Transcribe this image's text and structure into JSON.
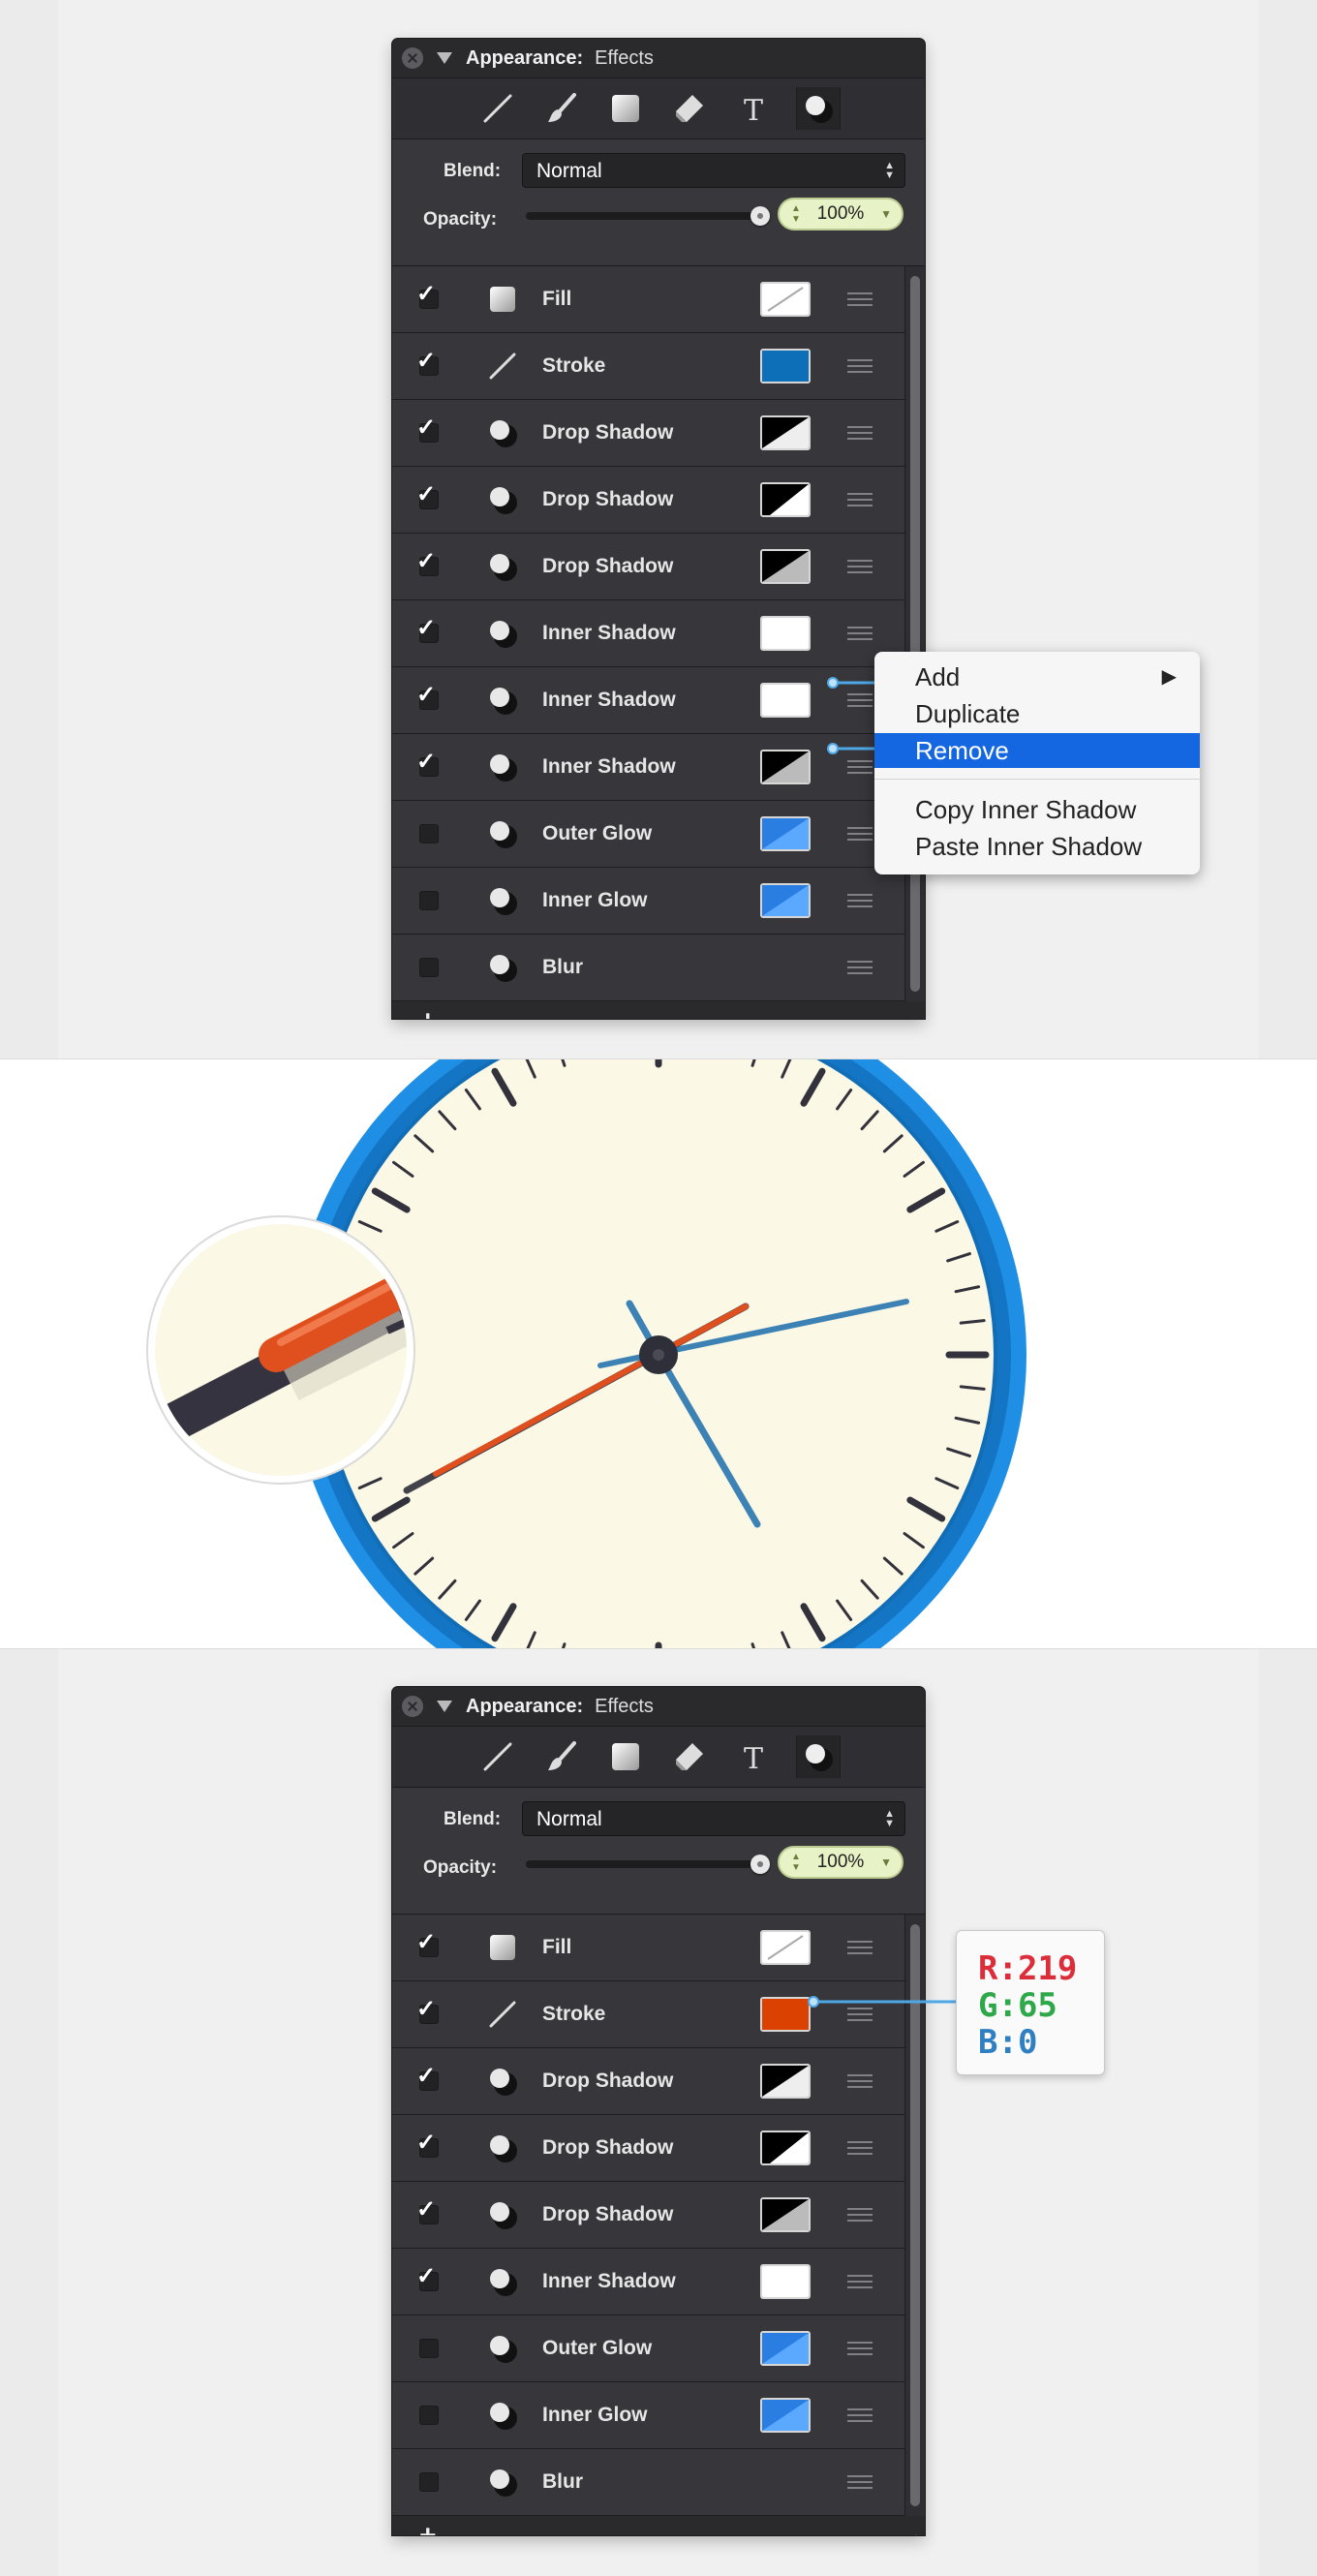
{
  "panel_top": {
    "title": "Appearance:",
    "subtitle": "Effects",
    "blend_label": "Blend:",
    "blend_value": "Normal",
    "opacity_label": "Opacity:",
    "opacity_value": "100%",
    "rows": [
      {
        "label": "Fill",
        "checked": true,
        "icon": "fill-icon",
        "swatch": "fill"
      },
      {
        "label": "Stroke",
        "checked": true,
        "icon": "stroke-icon",
        "swatch": "blue"
      },
      {
        "label": "Drop Shadow",
        "checked": true,
        "icon": "effect-icon",
        "swatch": "bw1"
      },
      {
        "label": "Drop Shadow",
        "checked": true,
        "icon": "effect-icon",
        "swatch": "bw2"
      },
      {
        "label": "Drop Shadow",
        "checked": true,
        "icon": "effect-icon",
        "swatch": "bw3"
      },
      {
        "label": "Inner Shadow",
        "checked": true,
        "icon": "effect-icon",
        "swatch": "white"
      },
      {
        "label": "Inner Shadow",
        "checked": true,
        "icon": "effect-icon",
        "swatch": "white"
      },
      {
        "label": "Inner Shadow",
        "checked": true,
        "icon": "effect-icon",
        "swatch": "bw3"
      },
      {
        "label": "Outer Glow",
        "checked": false,
        "icon": "effect-icon",
        "swatch": "glow"
      },
      {
        "label": "Inner Glow",
        "checked": false,
        "icon": "effect-icon",
        "swatch": "glow"
      },
      {
        "label": "Blur",
        "checked": false,
        "icon": "effect-icon",
        "swatch": "none"
      }
    ]
  },
  "context_menu": {
    "items": [
      "Add",
      "Duplicate",
      "Remove",
      "Copy Inner Shadow",
      "Paste Inner Shadow"
    ],
    "selected": "Remove"
  },
  "panel_bottom": {
    "title": "Appearance:",
    "subtitle": "Effects",
    "blend_label": "Blend:",
    "blend_value": "Normal",
    "opacity_label": "Opacity:",
    "opacity_value": "100%",
    "rows": [
      {
        "label": "Fill",
        "checked": true,
        "icon": "fill-icon",
        "swatch": "fill"
      },
      {
        "label": "Stroke",
        "checked": true,
        "icon": "stroke-icon",
        "swatch": "red"
      },
      {
        "label": "Drop Shadow",
        "checked": true,
        "icon": "effect-icon",
        "swatch": "bw1"
      },
      {
        "label": "Drop Shadow",
        "checked": true,
        "icon": "effect-icon",
        "swatch": "bw2"
      },
      {
        "label": "Drop Shadow",
        "checked": true,
        "icon": "effect-icon",
        "swatch": "bw3"
      },
      {
        "label": "Inner Shadow",
        "checked": true,
        "icon": "effect-icon",
        "swatch": "white"
      },
      {
        "label": "Outer Glow",
        "checked": false,
        "icon": "effect-icon",
        "swatch": "glow"
      },
      {
        "label": "Inner Glow",
        "checked": false,
        "icon": "effect-icon",
        "swatch": "glow"
      },
      {
        "label": "Blur",
        "checked": false,
        "icon": "effect-icon",
        "swatch": "none"
      }
    ]
  },
  "rgb_tooltip": {
    "r": "R:219",
    "g": "G:65",
    "b": "B:0"
  },
  "colors": {
    "stroke_blue": "#0d6fb8",
    "stroke_red": "#db4100",
    "menu_selected": "#1467e0",
    "clock_ring": "#1a86d9",
    "clock_face": "#fbf8e8",
    "hand_orange": "#e0501e",
    "hand_blue": "#3d82b5"
  }
}
